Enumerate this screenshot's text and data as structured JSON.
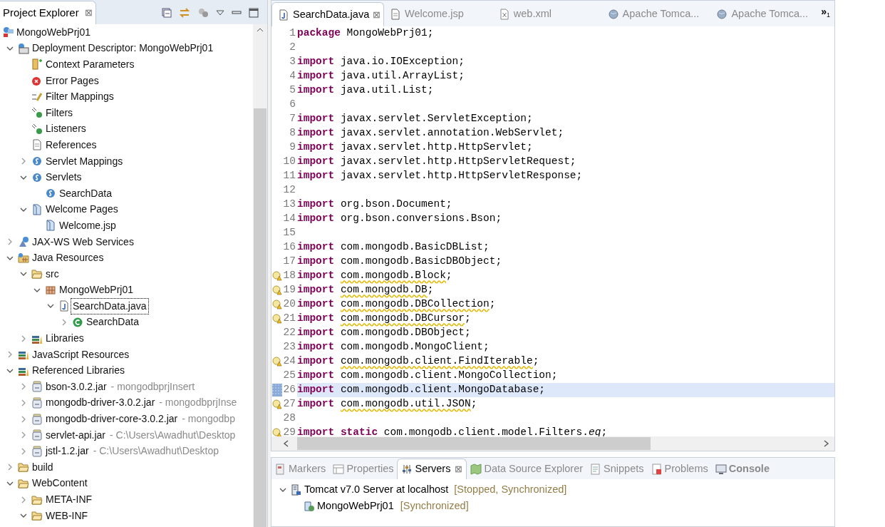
{
  "explorer": {
    "title": "Project Explorer",
    "close": "⊠",
    "project": {
      "label": "MongoWebPrj01",
      "kind": "project",
      "selected": false,
      "children": [
        {
          "label": "Deployment Descriptor: MongoWebPrj01",
          "kind": "descriptor",
          "expanded": true,
          "selected": false,
          "children": [
            {
              "label": "Context Parameters",
              "kind": "params",
              "selected": false
            },
            {
              "label": "Error Pages",
              "kind": "error",
              "selected": false
            },
            {
              "label": "Filter Mappings",
              "kind": "filter",
              "selected": false
            },
            {
              "label": "Filters",
              "kind": "listener",
              "selected": false
            },
            {
              "label": "Listeners",
              "kind": "listener",
              "selected": false
            },
            {
              "label": "References",
              "kind": "doc",
              "selected": false
            },
            {
              "label": "Servlet Mappings",
              "kind": "servlet",
              "expanded": false,
              "selected": false
            },
            {
              "label": "Servlets",
              "kind": "servlet",
              "expanded": true,
              "selected": false,
              "children": [
                {
                  "label": "SearchData",
                  "kind": "servlet",
                  "selected": false
                }
              ]
            },
            {
              "label": "Welcome Pages",
              "kind": "pages",
              "expanded": true,
              "selected": false,
              "children": [
                {
                  "label": "Welcome.jsp",
                  "kind": "pages",
                  "selected": false
                }
              ]
            }
          ]
        },
        {
          "label": "JAX-WS Web Services",
          "kind": "webservice",
          "expanded": false,
          "selected": false
        },
        {
          "label": "Java Resources",
          "kind": "resources",
          "expanded": true,
          "selected": false,
          "children": [
            {
              "label": "src",
              "kind": "folder",
              "expanded": true,
              "selected": false,
              "children": [
                {
                  "label": "MongoWebPrj01",
                  "kind": "package",
                  "expanded": true,
                  "selected": false,
                  "children": [
                    {
                      "label": "SearchData.java",
                      "kind": "javafile",
                      "expanded": true,
                      "selected": true,
                      "children": [
                        {
                          "label": "SearchData",
                          "kind": "class",
                          "expanded": false,
                          "selected": false
                        }
                      ]
                    }
                  ]
                }
              ]
            },
            {
              "label": "Libraries",
              "kind": "library",
              "expanded": false,
              "selected": false
            }
          ]
        },
        {
          "label": "JavaScript Resources",
          "kind": "library",
          "expanded": false,
          "selected": false
        },
        {
          "label": "Referenced Libraries",
          "kind": "library",
          "expanded": true,
          "selected": false,
          "children": [
            {
              "label": "bson-3.0.2.jar",
              "suffix": "- mongodbprjInsert",
              "kind": "jar",
              "expanded": false,
              "selected": false
            },
            {
              "label": "mongodb-driver-3.0.2.jar",
              "suffix": "- mongodbprjInse",
              "kind": "jar",
              "expanded": false,
              "selected": false
            },
            {
              "label": "mongodb-driver-core-3.0.2.jar",
              "suffix": "- mongodbp",
              "kind": "jar",
              "expanded": false,
              "selected": false
            },
            {
              "label": "servlet-api.jar",
              "suffix": "- C:\\Users\\Awadhut\\Desktop",
              "kind": "jar",
              "expanded": false,
              "selected": false
            },
            {
              "label": "jstl-1.2.jar",
              "suffix": "- C:\\Users\\Awadhut\\Desktop",
              "kind": "jar",
              "expanded": false,
              "selected": false
            }
          ]
        },
        {
          "label": "build",
          "kind": "folder",
          "expanded": false,
          "selected": false
        },
        {
          "label": "WebContent",
          "kind": "folder",
          "expanded": true,
          "selected": false,
          "children": [
            {
              "label": "META-INF",
              "kind": "folder",
              "expanded": false,
              "selected": false
            },
            {
              "label": "WEB-INF",
              "kind": "folder",
              "expanded": true,
              "selected": false
            }
          ]
        }
      ]
    }
  },
  "editor": {
    "tabs": [
      {
        "label": "SearchData.java",
        "kind": "java",
        "selected": true,
        "close": "⊠"
      },
      {
        "label": "Welcome.jsp",
        "kind": "doc",
        "selected": false
      },
      {
        "label": "web.xml",
        "kind": "xml",
        "selected": false
      },
      {
        "label": "Apache Tomca...",
        "kind": "web",
        "selected": false
      },
      {
        "label": "Apache Tomca...",
        "kind": "web",
        "selected": false
      }
    ],
    "overflow": {
      "symbol": "»",
      "count": "1"
    },
    "lines": [
      {
        "number": "1",
        "warning": false,
        "diff": false,
        "current": false,
        "segments": [
          {
            "kind": "keyword",
            "text": "package"
          },
          {
            "kind": "plain",
            "text": " MongoWebPrj01;"
          }
        ]
      },
      {
        "number": "2",
        "warning": false,
        "diff": false,
        "current": false
      },
      {
        "number": "3",
        "warning": false,
        "diff": false,
        "current": false,
        "segments": [
          {
            "kind": "keyword",
            "text": "import"
          },
          {
            "kind": "plain",
            "text": " java.io.IOException;"
          }
        ]
      },
      {
        "number": "4",
        "warning": false,
        "diff": false,
        "current": false,
        "segments": [
          {
            "kind": "keyword",
            "text": "import"
          },
          {
            "kind": "plain",
            "text": " java.util.ArrayList;"
          }
        ]
      },
      {
        "number": "5",
        "warning": false,
        "diff": false,
        "current": false,
        "segments": [
          {
            "kind": "keyword",
            "text": "import"
          },
          {
            "kind": "plain",
            "text": " java.util.List;"
          }
        ]
      },
      {
        "number": "6",
        "warning": false,
        "diff": false,
        "current": false
      },
      {
        "number": "7",
        "warning": false,
        "diff": false,
        "current": false,
        "segments": [
          {
            "kind": "keyword",
            "text": "import"
          },
          {
            "kind": "plain",
            "text": " javax.servlet.ServletException;"
          }
        ]
      },
      {
        "number": "8",
        "warning": false,
        "diff": false,
        "current": false,
        "segments": [
          {
            "kind": "keyword",
            "text": "import"
          },
          {
            "kind": "plain",
            "text": " javax.servlet.annotation.WebServlet;"
          }
        ]
      },
      {
        "number": "9",
        "warning": false,
        "diff": false,
        "current": false,
        "segments": [
          {
            "kind": "keyword",
            "text": "import"
          },
          {
            "kind": "plain",
            "text": " javax.servlet.http.HttpServlet;"
          }
        ]
      },
      {
        "number": "10",
        "warning": false,
        "diff": false,
        "current": false,
        "segments": [
          {
            "kind": "keyword",
            "text": "import"
          },
          {
            "kind": "plain",
            "text": " javax.servlet.http.HttpServletRequest;"
          }
        ]
      },
      {
        "number": "11",
        "warning": false,
        "diff": false,
        "current": false,
        "segments": [
          {
            "kind": "keyword",
            "text": "import"
          },
          {
            "kind": "plain",
            "text": " javax.servlet.http.HttpServletResponse;"
          }
        ]
      },
      {
        "number": "12",
        "warning": false,
        "diff": false,
        "current": false
      },
      {
        "number": "13",
        "warning": false,
        "diff": false,
        "current": false,
        "segments": [
          {
            "kind": "keyword",
            "text": "import"
          },
          {
            "kind": "plain",
            "text": " org.bson.Document;"
          }
        ]
      },
      {
        "number": "14",
        "warning": false,
        "diff": false,
        "current": false,
        "segments": [
          {
            "kind": "keyword",
            "text": "import"
          },
          {
            "kind": "plain",
            "text": " org.bson.conversions.Bson;"
          }
        ]
      },
      {
        "number": "15",
        "warning": false,
        "diff": false,
        "current": false
      },
      {
        "number": "16",
        "warning": false,
        "diff": false,
        "current": false,
        "segments": [
          {
            "kind": "keyword",
            "text": "import"
          },
          {
            "kind": "plain",
            "text": " com.mongodb.BasicDBList;"
          }
        ]
      },
      {
        "number": "17",
        "warning": false,
        "diff": false,
        "current": false,
        "segments": [
          {
            "kind": "keyword",
            "text": "import"
          },
          {
            "kind": "plain",
            "text": " com.mongodb.BasicDBObject;"
          }
        ]
      },
      {
        "number": "18",
        "warning": true,
        "diff": false,
        "current": false,
        "segments": [
          {
            "kind": "keyword",
            "text": "import "
          },
          {
            "kind": "warned",
            "text": "com.mongodb.Block"
          },
          {
            "kind": "plain",
            "text": ";"
          }
        ]
      },
      {
        "number": "19",
        "warning": true,
        "diff": false,
        "current": false,
        "segments": [
          {
            "kind": "keyword",
            "text": "import "
          },
          {
            "kind": "warned",
            "text": "com.mongodb.DB"
          },
          {
            "kind": "plain",
            "text": ";"
          }
        ]
      },
      {
        "number": "20",
        "warning": true,
        "diff": false,
        "current": false,
        "segments": [
          {
            "kind": "keyword",
            "text": "import "
          },
          {
            "kind": "warned",
            "text": "com.mongodb.DBCollection"
          },
          {
            "kind": "plain",
            "text": ";"
          }
        ]
      },
      {
        "number": "21",
        "warning": true,
        "diff": false,
        "current": false,
        "segments": [
          {
            "kind": "keyword",
            "text": "import "
          },
          {
            "kind": "warned",
            "text": "com.mongodb.DBCursor"
          },
          {
            "kind": "plain",
            "text": ";"
          }
        ]
      },
      {
        "number": "22",
        "warning": false,
        "diff": false,
        "current": false,
        "segments": [
          {
            "kind": "keyword",
            "text": "import"
          },
          {
            "kind": "plain",
            "text": " com.mongodb.DBObject;"
          }
        ]
      },
      {
        "number": "23",
        "warning": false,
        "diff": false,
        "current": false,
        "segments": [
          {
            "kind": "keyword",
            "text": "import"
          },
          {
            "kind": "plain",
            "text": " com.mongodb.MongoClient;"
          }
        ]
      },
      {
        "number": "24",
        "warning": true,
        "diff": false,
        "current": false,
        "segments": [
          {
            "kind": "keyword",
            "text": "import "
          },
          {
            "kind": "warned",
            "text": "com.mongodb.client.FindIterable"
          },
          {
            "kind": "plain",
            "text": ";"
          }
        ]
      },
      {
        "number": "25",
        "warning": false,
        "diff": false,
        "current": false,
        "segments": [
          {
            "kind": "keyword",
            "text": "import"
          },
          {
            "kind": "plain",
            "text": " com.mongodb.client.MongoCollection;"
          }
        ]
      },
      {
        "number": "26",
        "warning": false,
        "diff": true,
        "current": true,
        "segments": [
          {
            "kind": "keyword",
            "text": "import"
          },
          {
            "kind": "plain",
            "text": " com.mongodb.client.MongoDatabase;"
          }
        ]
      },
      {
        "number": "27",
        "warning": true,
        "diff": false,
        "current": false,
        "segments": [
          {
            "kind": "keyword",
            "text": "import "
          },
          {
            "kind": "warned",
            "text": "com.mongodb.util.JSON"
          },
          {
            "kind": "plain",
            "text": ";"
          }
        ]
      },
      {
        "number": "28",
        "warning": false,
        "diff": false,
        "current": false
      },
      {
        "number": "29",
        "warning": true,
        "diff": false,
        "current": false,
        "segments": [
          {
            "kind": "keyword",
            "text": "import static "
          },
          {
            "kind": "warned",
            "text": "com.mongodb.client.model.Filters."
          },
          {
            "kind": "warned-italic",
            "text": "eq"
          },
          {
            "kind": "plain",
            "text": ";"
          }
        ]
      }
    ]
  },
  "bottom": {
    "tabs": [
      {
        "label": "Markers",
        "kind": "markers",
        "selected": false,
        "updated": false
      },
      {
        "label": "Properties",
        "kind": "properties",
        "selected": false,
        "updated": false
      },
      {
        "label": "Servers",
        "kind": "servers",
        "selected": true,
        "updated": false,
        "close": "⊠"
      },
      {
        "label": "Data Source Explorer",
        "kind": "datasource",
        "selected": false,
        "updated": false
      },
      {
        "label": "Snippets",
        "kind": "snippets",
        "selected": false,
        "updated": false
      },
      {
        "label": "Problems",
        "kind": "problems",
        "selected": false,
        "updated": false
      },
      {
        "label": "Console",
        "kind": "console",
        "selected": false,
        "updated": true
      }
    ],
    "servers": [
      {
        "label": "Tomcat v7.0 Server at localhost",
        "status": "[Stopped, Synchronized]",
        "kind": "server",
        "expanded": true,
        "children": [
          {
            "label": "MongoWebPrj01",
            "status": "[Synchronized]",
            "kind": "module"
          }
        ]
      }
    ]
  }
}
